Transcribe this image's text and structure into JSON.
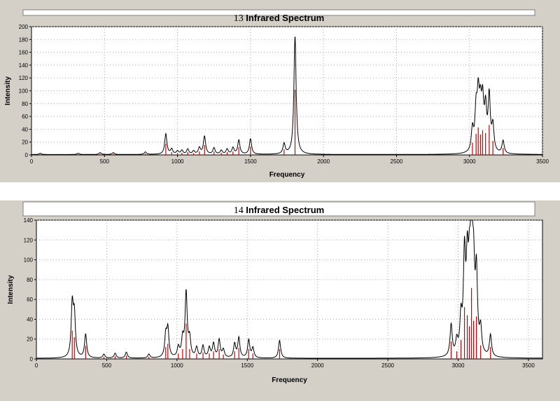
{
  "chart_data": [
    {
      "type": "line",
      "title_number": "13",
      "title_text": "Infrared Spectrum",
      "xlabel": "Frequency",
      "ylabel": "Intensity",
      "xlim": [
        0,
        3500
      ],
      "ylim": [
        0,
        200
      ],
      "xticks": [
        0,
        500,
        1000,
        1500,
        2000,
        2500,
        3000,
        3500
      ],
      "yticks": [
        0,
        20,
        40,
        60,
        80,
        100,
        120,
        140,
        160,
        180,
        200
      ],
      "grid": true,
      "line_color": "#000000",
      "stick_color": "#cc0000",
      "peaks": [
        [
          60,
          2
        ],
        [
          320,
          2
        ],
        [
          470,
          3
        ],
        [
          560,
          3
        ],
        [
          780,
          4
        ],
        [
          920,
          32
        ],
        [
          960,
          8
        ],
        [
          1000,
          5
        ],
        [
          1030,
          6
        ],
        [
          1070,
          8
        ],
        [
          1110,
          5
        ],
        [
          1150,
          10
        ],
        [
          1185,
          28
        ],
        [
          1250,
          10
        ],
        [
          1300,
          6
        ],
        [
          1340,
          8
        ],
        [
          1380,
          10
        ],
        [
          1420,
          22
        ],
        [
          1500,
          24
        ],
        [
          1730,
          16
        ],
        [
          1805,
          185
        ],
        [
          3020,
          35
        ],
        [
          3045,
          60
        ],
        [
          3060,
          78
        ],
        [
          3075,
          58
        ],
        [
          3090,
          70
        ],
        [
          3110,
          62
        ],
        [
          3135,
          85
        ],
        [
          3160,
          40
        ],
        [
          3230,
          20
        ]
      ]
    },
    {
      "type": "line",
      "title_number": "14",
      "title_text": "Infrared Spectrum",
      "xlabel": "Frequency",
      "ylabel": "Intensity",
      "xlim": [
        0,
        3600
      ],
      "ylim": [
        0,
        140
      ],
      "xticks": [
        0,
        500,
        1000,
        1500,
        2000,
        2500,
        3000,
        3500
      ],
      "yticks": [
        0,
        20,
        40,
        60,
        80,
        100,
        120,
        140
      ],
      "grid": true,
      "line_color": "#000000",
      "stick_color": "#cc0000",
      "peaks": [
        [
          255,
          52
        ],
        [
          270,
          40
        ],
        [
          350,
          24
        ],
        [
          480,
          4
        ],
        [
          560,
          5
        ],
        [
          640,
          6
        ],
        [
          800,
          4
        ],
        [
          920,
          22
        ],
        [
          935,
          28
        ],
        [
          1010,
          10
        ],
        [
          1040,
          18
        ],
        [
          1065,
          65
        ],
        [
          1090,
          18
        ],
        [
          1140,
          10
        ],
        [
          1185,
          12
        ],
        [
          1230,
          10
        ],
        [
          1260,
          14
        ],
        [
          1300,
          18
        ],
        [
          1330,
          8
        ],
        [
          1410,
          14
        ],
        [
          1440,
          20
        ],
        [
          1510,
          18
        ],
        [
          1540,
          10
        ],
        [
          1730,
          18
        ],
        [
          2950,
          32
        ],
        [
          2990,
          14
        ],
        [
          3020,
          35
        ],
        [
          3045,
          95
        ],
        [
          3065,
          80
        ],
        [
          3080,
          60
        ],
        [
          3095,
          130
        ],
        [
          3110,
          70
        ],
        [
          3130,
          78
        ],
        [
          3160,
          25
        ],
        [
          3230,
          22
        ]
      ]
    }
  ]
}
